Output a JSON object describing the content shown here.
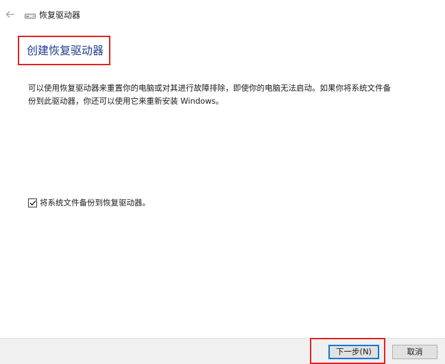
{
  "window": {
    "title": "恢复驱动器",
    "icons": {
      "back": "back-arrow-icon",
      "drive": "drive-icon"
    }
  },
  "main": {
    "heading": "创建恢复驱动器",
    "description": "可以使用恢复驱动器来重置你的电脑或对其进行故障排除，即使你的电脑无法启动。如果你将系统文件备份到此驱动器，你还可以使用它来重新安装 Windows。",
    "checkbox": {
      "label": "将系统文件备份到恢复驱动器。",
      "checked": true,
      "icon": "checkmark-icon"
    }
  },
  "footer": {
    "next_label": "下一步(N)",
    "cancel_label": "取消"
  },
  "colors": {
    "heading": "#1f3d8f",
    "highlight": "#e02020",
    "focus": "#0078d7"
  }
}
